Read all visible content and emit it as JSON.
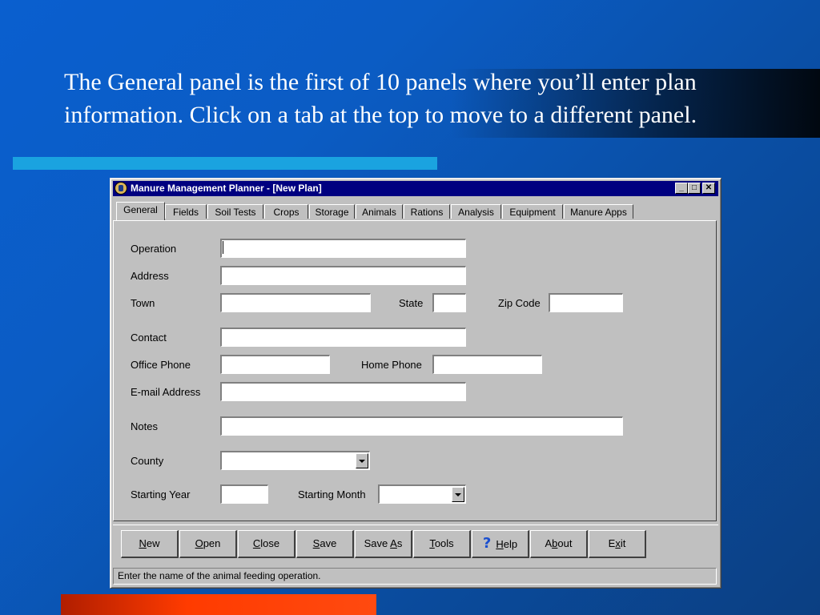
{
  "slide": {
    "text_before": "The ",
    "text_bold": "General",
    "text_after": " panel is the first of 10 panels where you’ll enter plan information. Click on a tab at the top to move to a different panel."
  },
  "window": {
    "title": "Manure Management Planner - [New Plan]",
    "controls": {
      "minimize": "_",
      "maximize": "□",
      "close": "✕"
    },
    "tabs": [
      "General",
      "Fields",
      "Soil Tests",
      "Crops",
      "Storage",
      "Animals",
      "Rations",
      "Analysis",
      "Equipment",
      "Manure Apps"
    ],
    "active_tab": "General",
    "form": {
      "operation_label": "Operation",
      "address_label": "Address",
      "town_label": "Town",
      "state_label": "State",
      "zip_label": "Zip Code",
      "contact_label": "Contact",
      "office_phone_label": "Office Phone",
      "home_phone_label": "Home Phone",
      "email_label": "E-mail Address",
      "notes_label": "Notes",
      "county_label": "County",
      "starting_year_label": "Starting Year",
      "starting_month_label": "Starting Month",
      "values": {
        "operation": "",
        "address": "",
        "town": "",
        "state": "",
        "zip": "",
        "contact": "",
        "office_phone": "",
        "home_phone": "",
        "email": "",
        "notes": "",
        "county": "",
        "starting_year": "",
        "starting_month": ""
      }
    },
    "buttons": {
      "new": {
        "pre": "",
        "key": "N",
        "post": "ew"
      },
      "open": {
        "pre": "",
        "key": "O",
        "post": "pen"
      },
      "close": {
        "pre": "",
        "key": "C",
        "post": "lose"
      },
      "save": {
        "pre": "",
        "key": "S",
        "post": "ave"
      },
      "save_as": {
        "pre": "Save ",
        "key": "A",
        "post": "s"
      },
      "tools": {
        "pre": "",
        "key": "T",
        "post": "ools"
      },
      "help": {
        "pre": "",
        "key": "H",
        "post": "elp",
        "icon": "?"
      },
      "about": {
        "pre": "A",
        "key": "b",
        "post": "out"
      },
      "exit": {
        "pre": "E",
        "key": "x",
        "post": "it"
      }
    },
    "status_text": "Enter the name of the animal feeding operation."
  },
  "colors": {
    "titlebar": "#000080",
    "window_face": "#c0c0c0",
    "accent_cyan": "#1aa3e0",
    "accent_red": "#ff3b00"
  }
}
